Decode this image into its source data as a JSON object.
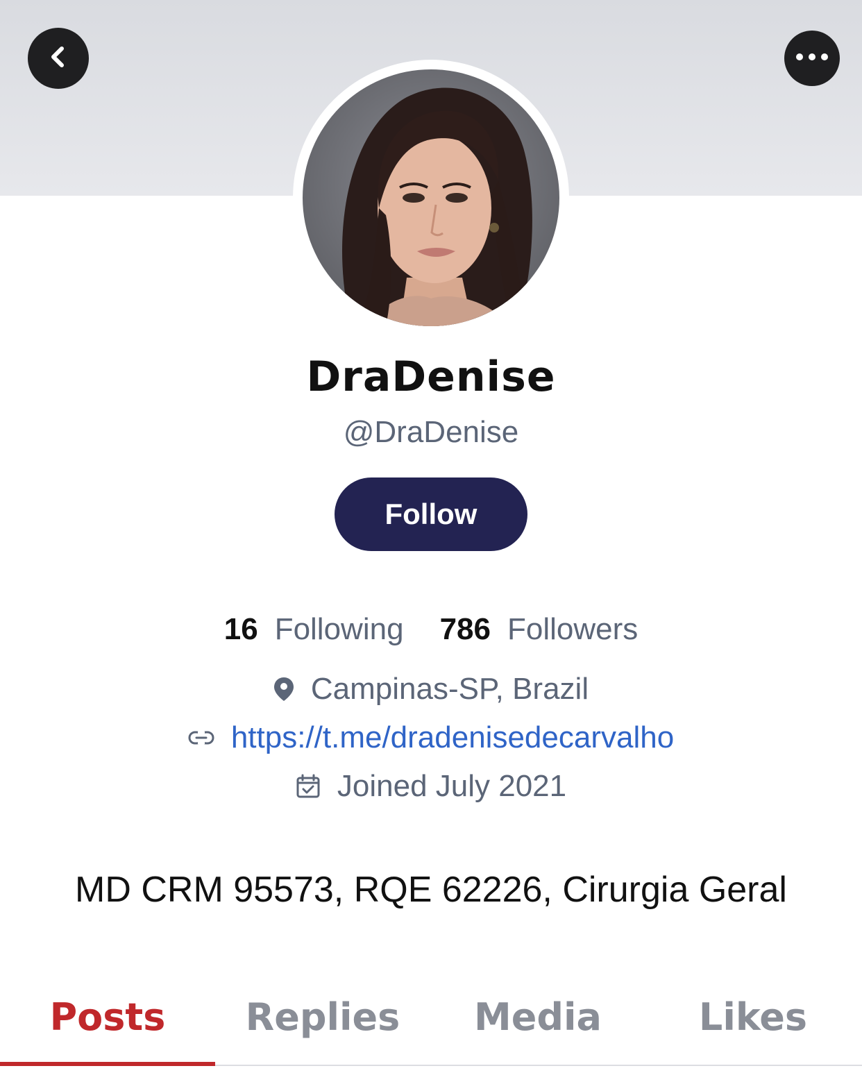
{
  "header": {
    "back_icon": "chevron-left-icon",
    "more_icon": "more-horizontal-icon"
  },
  "profile": {
    "display_name": "DraDenise",
    "handle": "@DraDenise",
    "follow_label": "Follow",
    "following_count": "16",
    "following_label": "Following",
    "followers_count": "786",
    "followers_label": "Followers",
    "location": "Campinas-SP, Brazil",
    "website": "https://t.me/dradenisedecarvalho",
    "joined": "Joined July 2021",
    "bio": "MD CRM 95573, RQE 62226, Cirurgia Geral"
  },
  "tabs": [
    {
      "label": "Posts",
      "active": true
    },
    {
      "label": "Replies",
      "active": false
    },
    {
      "label": "Media",
      "active": false
    },
    {
      "label": "Likes",
      "active": false
    }
  ],
  "colors": {
    "follow_button": "#232352",
    "active_tab": "#c0282b",
    "link": "#2f64c7",
    "secondary_text": "#5b6577"
  }
}
